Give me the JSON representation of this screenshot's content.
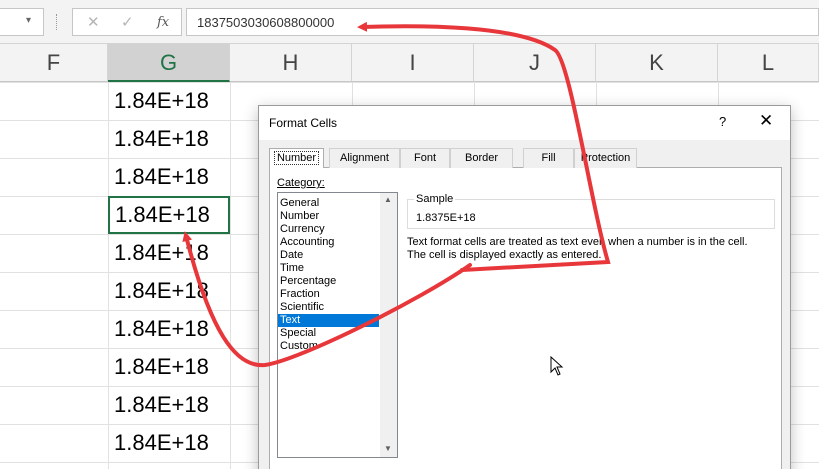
{
  "formula_bar": {
    "name_box_dropdown": "▾",
    "cancel_icon": "✕",
    "enter_icon": "✓",
    "fx_label": "fx",
    "value": "1837503030608800000"
  },
  "columns": [
    "F",
    "G",
    "H",
    "I",
    "J",
    "K",
    "L"
  ],
  "selected_column": "G",
  "column_g_cells": [
    "1.84E+18",
    "1.84E+18",
    "1.84E+18",
    "1.84E+18",
    "1.84E+18",
    "1.84E+18",
    "1.84E+18",
    "1.84E+18",
    "1.84E+18",
    "1.84E+18"
  ],
  "active_cell_index": 3,
  "dialog": {
    "title": "Format Cells",
    "help_label": "?",
    "close_label": "✕",
    "tabs": [
      "Number",
      "Alignment",
      "Font",
      "Border",
      "Fill",
      "Protection"
    ],
    "active_tab": "Number",
    "category_label": "Category:",
    "categories": [
      "General",
      "Number",
      "Currency",
      "Accounting",
      "Date",
      "Time",
      "Percentage",
      "Fraction",
      "Scientific",
      "Text",
      "Special",
      "Custom"
    ],
    "selected_category": "Text",
    "sample_label": "Sample",
    "sample_value": "1.8375E+18",
    "description_line1": "Text format cells are treated as text even when a number is in the cell.",
    "description_line2": "The cell is displayed exactly as entered."
  },
  "colors": {
    "excel_green": "#217346",
    "selection_blue": "#0078d7",
    "arrow_red": "#e8373b"
  }
}
